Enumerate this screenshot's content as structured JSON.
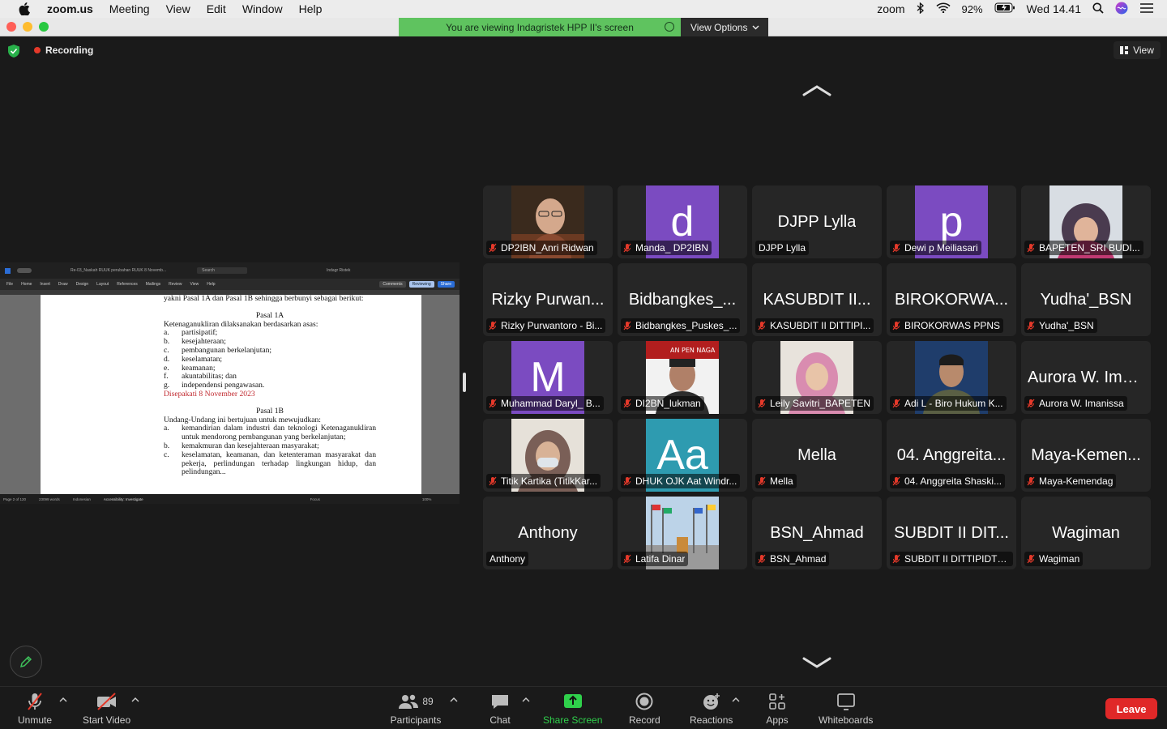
{
  "menubar": {
    "app": "zoom.us",
    "items": [
      "Meeting",
      "View",
      "Edit",
      "Window",
      "Help"
    ],
    "zoom_label": "zoom",
    "battery": "92%",
    "clock": "Wed 14.41"
  },
  "share_banner": {
    "text": "You are viewing Indagristek HPP II's screen",
    "view_options": "View Options"
  },
  "main": {
    "recording": "Recording",
    "view_button": "View"
  },
  "shared_doc": {
    "title": "Re-03_Naskah RUUK perubahan RUUK 8 Novemb...",
    "search": "Search",
    "user": "Indagr Ristek",
    "menu": [
      "File",
      "Home",
      "Insert",
      "Draw",
      "Design",
      "Layout",
      "References",
      "Mailings",
      "Review",
      "View",
      "Help"
    ],
    "comments": "Comments",
    "reviewing": "Reviewing",
    "share": "Share",
    "intro": "yakni Pasal 1A dan Pasal 1B sehingga berbunyi sebagai berikut:",
    "pasal1a": "Pasal 1A",
    "pasal1a_text": "Ketenaganukliran dilaksanakan berdasarkan asas:",
    "items1a": [
      {
        "k": "a.",
        "t": "partisipatif;"
      },
      {
        "k": "b.",
        "t": "kesejahteraan;"
      },
      {
        "k": "c.",
        "t": "pembangunan berkelanjutan;"
      },
      {
        "k": "d.",
        "t": "keselamatan;"
      },
      {
        "k": "e.",
        "t": "keamanan;"
      },
      {
        "k": "f.",
        "t": "akuntabilitas; dan"
      },
      {
        "k": "g.",
        "t": "independensi pengawasan."
      }
    ],
    "agreed": "Disepakati 8 November 2023",
    "pasal1b": "Pasal 1B",
    "pasal1b_text": "Undang-Undang ini bertujuan untuk mewujudkan:",
    "items1b": [
      {
        "k": "a.",
        "t": "kemandirian dalam industri dan teknologi Ketenaganukliran untuk mendorong pembangunan yang berkelanjutan;"
      },
      {
        "k": "b.",
        "t": "kemakmuran dan kesejahteraan masyarakat;"
      },
      {
        "k": "c.",
        "t": "keselamatan, keamanan, dan ketenteraman masyarakat dan pekerja, perlindungan terhadap lingkungan hidup, dan pelindungan..."
      }
    ],
    "status_page": "Page 2 of 120",
    "status_words": "23099 words",
    "status_lang": "Indonesian",
    "status_access": "Accessibility: Investigate",
    "status_focus": "Focus",
    "status_zoom": "100%"
  },
  "participants": [
    {
      "big": "",
      "label": "DP2IBN_Anri Ridwan",
      "muted": true,
      "kind": "photo",
      "photo": "man-glasses"
    },
    {
      "big": "d",
      "label": "Manda_ DP2IBN",
      "muted": true,
      "kind": "letter",
      "color": "#7b4bc1"
    },
    {
      "big": "DJPP Lylla",
      "label": "DJPP Lylla",
      "muted": false,
      "kind": "name"
    },
    {
      "big": "p",
      "label": "Dewi p Meiliasari",
      "muted": true,
      "kind": "letter",
      "color": "#7b4bc1"
    },
    {
      "big": "",
      "label": "BAPETEN_SRI BUDI...",
      "muted": true,
      "kind": "photo",
      "photo": "woman-snow"
    },
    {
      "big": "Rizky Purwan...",
      "label": "Rizky Purwantoro - Bi...",
      "muted": true,
      "kind": "name"
    },
    {
      "big": "Bidbangkes_...",
      "label": "Bidbangkes_Puskes_...",
      "muted": true,
      "kind": "name"
    },
    {
      "big": "KASUBDIT II...",
      "label": "KASUBDIT II DITTIPI...",
      "muted": true,
      "kind": "name"
    },
    {
      "big": "BIROKORWA...",
      "label": "BIROKORWAS PPNS",
      "muted": true,
      "kind": "name"
    },
    {
      "big": "Yudha'_BSN",
      "label": "Yudha'_BSN",
      "muted": true,
      "kind": "name"
    },
    {
      "big": "M",
      "label": "Muhammad Daryl_ B...",
      "muted": true,
      "kind": "letter",
      "color": "#7b4bc1"
    },
    {
      "big": "",
      "label": "DI2BN_lukman",
      "muted": true,
      "kind": "photo",
      "photo": "man-banner"
    },
    {
      "big": "",
      "label": "Leily Savitri_BAPETEN",
      "muted": true,
      "kind": "photo",
      "photo": "woman-hijab"
    },
    {
      "big": "",
      "label": "Adi L - Biro Hukum K...",
      "muted": true,
      "kind": "photo",
      "photo": "man-uniform"
    },
    {
      "big": "Aurora W. Ima...",
      "label": "Aurora W. Imanissa",
      "muted": true,
      "kind": "name"
    },
    {
      "big": "",
      "label": "Titik Kartika (TitikKar...",
      "muted": true,
      "kind": "photo",
      "photo": "woman-mask"
    },
    {
      "big": "Aa",
      "label": "DHUK OJK Aat Windr...",
      "muted": true,
      "kind": "letter",
      "color": "#2e9bb0"
    },
    {
      "big": "Mella",
      "label": "Mella",
      "muted": true,
      "kind": "name"
    },
    {
      "big": "04. Anggreita...",
      "label": "04. Anggreita Shaski...",
      "muted": true,
      "kind": "name"
    },
    {
      "big": "Maya-Kemen...",
      "label": "Maya-Kemendag",
      "muted": true,
      "kind": "name"
    },
    {
      "big": "Anthony",
      "label": "Anthony",
      "muted": false,
      "kind": "name"
    },
    {
      "big": "",
      "label": "Latifa Dinar",
      "muted": true,
      "kind": "photo",
      "photo": "flags"
    },
    {
      "big": "BSN_Ahmad",
      "label": "BSN_Ahmad",
      "muted": true,
      "kind": "name"
    },
    {
      "big": "SUBDIT II DIT...",
      "label": "SUBDIT II DITTIPIDTE...",
      "muted": true,
      "kind": "name"
    },
    {
      "big": "Wagiman",
      "label": "Wagiman",
      "muted": true,
      "kind": "name"
    }
  ],
  "toolbar": {
    "unmute": "Unmute",
    "start_video": "Start Video",
    "participants": "Participants",
    "participants_count": "89",
    "chat": "Chat",
    "share_screen": "Share Screen",
    "record": "Record",
    "reactions": "Reactions",
    "apps": "Apps",
    "whiteboards": "Whiteboards",
    "leave": "Leave"
  },
  "colors": {
    "share_green": "#5fc35f",
    "leave_red": "#e02828",
    "muted_red": "#e5392a",
    "accent_green": "#2fd04b"
  }
}
